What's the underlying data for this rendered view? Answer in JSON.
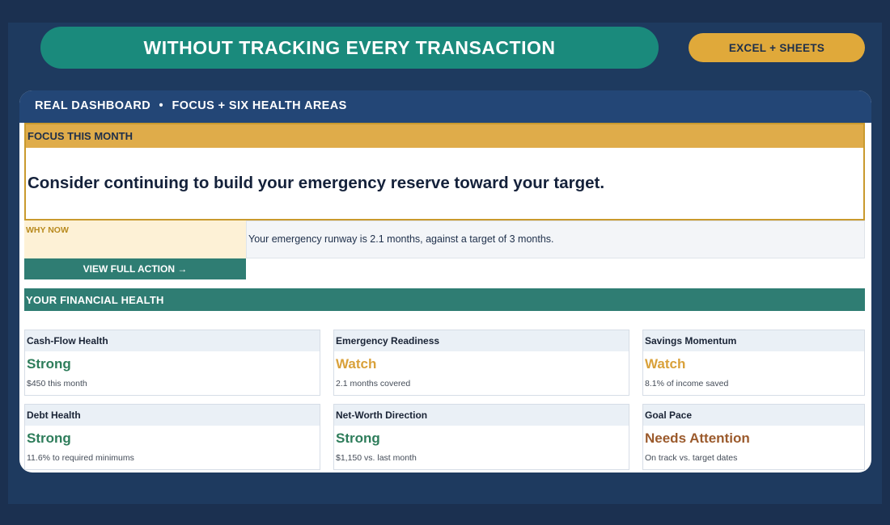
{
  "banner": {
    "title": "WITHOUT TRACKING EVERY TRANSACTION"
  },
  "badge": {
    "label": "EXCEL + SHEETS"
  },
  "dashboard": {
    "header_left": "REAL DASHBOARD",
    "header_sep": "•",
    "header_right": "FOCUS + SIX HEALTH AREAS"
  },
  "focus": {
    "heading": "FOCUS THIS MONTH",
    "message": "Consider continuing to build your emergency reserve toward your target.",
    "why_label": "WHY NOW",
    "why_text": "Your emergency runway is 2.1 months, against a target of 3 months.",
    "action_label": "VIEW FULL ACTION →"
  },
  "health": {
    "heading": "YOUR FINANCIAL HEALTH",
    "tiles": [
      {
        "title": "Cash-Flow Health",
        "status": "Strong",
        "detail": "$450 this month",
        "status_color": "#2e7d5b"
      },
      {
        "title": "Emergency Readiness",
        "status": "Watch",
        "detail": "2.1 months covered",
        "status_color": "#d9a13a"
      },
      {
        "title": "Savings Momentum",
        "status": "Watch",
        "detail": "8.1% of income saved",
        "status_color": "#d9a13a"
      },
      {
        "title": "Debt Health",
        "status": "Strong",
        "detail": "11.6% to required minimums",
        "status_color": "#2e7d5b"
      },
      {
        "title": "Net-Worth Direction",
        "status": "Strong",
        "detail": "$1,150 vs. last month",
        "status_color": "#2e7d5b"
      },
      {
        "title": "Goal Pace",
        "status": "Needs Attention",
        "detail": "On track vs. target dates",
        "status_color": "#9b5a2c"
      }
    ]
  },
  "colors": {
    "background": "#1b3050",
    "teal": "#1a8a7c",
    "gold": "#e0a93a",
    "navy_header": "#234676",
    "section_teal": "#2f7d73"
  }
}
